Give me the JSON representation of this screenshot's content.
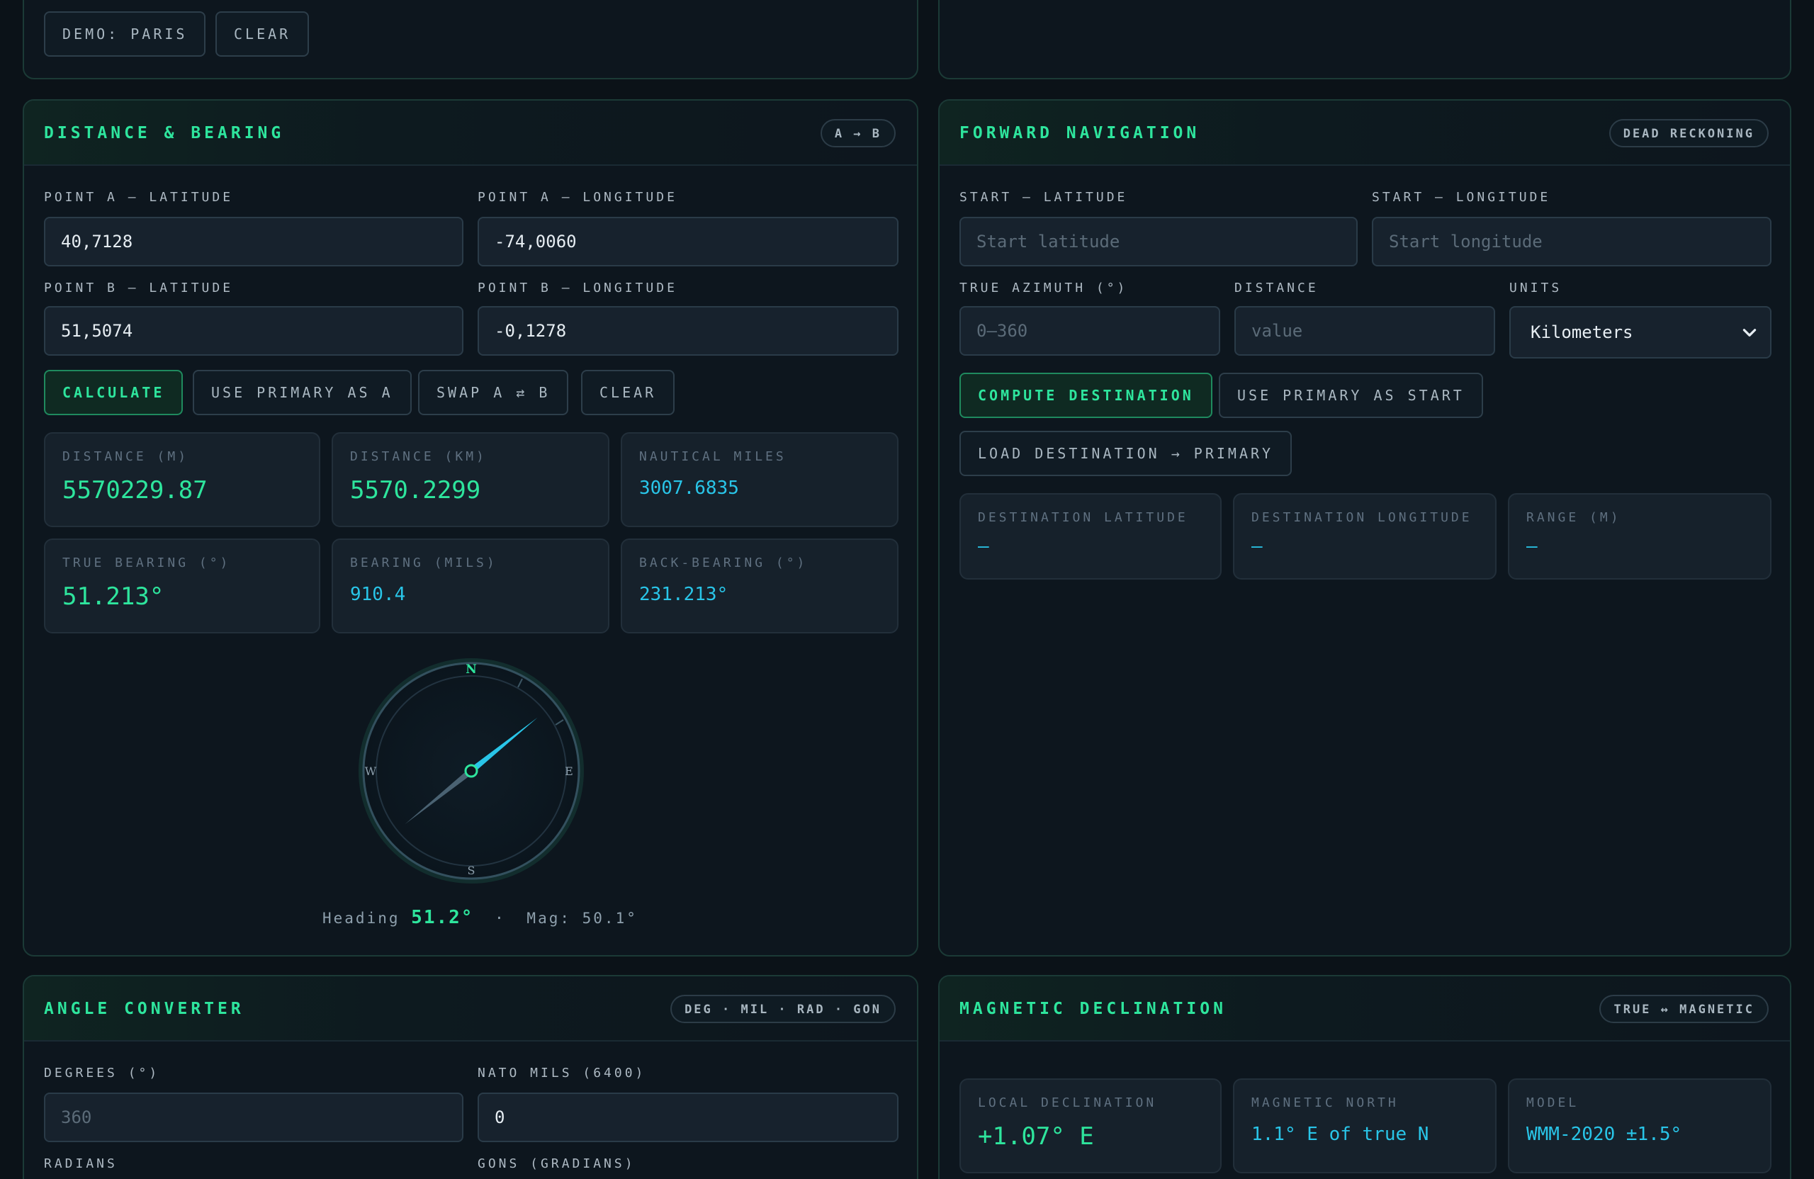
{
  "top_panel": {
    "demo_button": "DEMO: PARIS",
    "clear_button": "CLEAR"
  },
  "distance_bearing": {
    "title": "DISTANCE & BEARING",
    "badge": "A → B",
    "labels": {
      "a_lat": "POINT A — LATITUDE",
      "a_lon": "POINT A — LONGITUDE",
      "b_lat": "POINT B — LATITUDE",
      "b_lon": "POINT B — LONGITUDE"
    },
    "values": {
      "a_lat": "40,7128",
      "a_lon": "-74,0060",
      "b_lat": "51,5074",
      "b_lon": "-0,1278"
    },
    "buttons": {
      "calculate": "CALCULATE",
      "use_primary": "USE PRIMARY AS A",
      "swap": "SWAP A ⇄ B",
      "clear": "CLEAR"
    },
    "results": [
      {
        "label": "DISTANCE (M)",
        "value": "5570229.87"
      },
      {
        "label": "DISTANCE (KM)",
        "value": "5570.2299"
      },
      {
        "label": "NAUTICAL MILES",
        "value": "3007.6835"
      },
      {
        "label": "TRUE BEARING (°)",
        "value": "51.213°"
      },
      {
        "label": "BEARING (MILS)",
        "value": "910.4"
      },
      {
        "label": "BACK-BEARING (°)",
        "value": "231.213°"
      }
    ],
    "compass": {
      "n": "N",
      "e": "E",
      "s": "S",
      "w": "W",
      "bearing_deg": 51.2,
      "needle_color": "#29c5e8"
    },
    "heading": {
      "label": "Heading",
      "value": "51.2°",
      "separator": "·",
      "mag": "Mag: 50.1°"
    }
  },
  "forward_nav": {
    "title": "FORWARD NAVIGATION",
    "badge": "DEAD RECKONING",
    "labels": {
      "start_lat": "START — LATITUDE",
      "start_lon": "START — LONGITUDE",
      "azimuth": "TRUE AZIMUTH (°)",
      "distance": "DISTANCE",
      "units": "UNITS"
    },
    "placeholders": {
      "start_lat": "Start latitude",
      "start_lon": "Start longitude",
      "azimuth": "0–360",
      "distance": "value"
    },
    "units_value": "Kilometers",
    "buttons": {
      "compute": "COMPUTE DESTINATION",
      "use_primary": "USE PRIMARY AS START",
      "load": "LOAD DESTINATION → PRIMARY"
    },
    "results": [
      {
        "label": "DESTINATION LATITUDE",
        "value": "—"
      },
      {
        "label": "DESTINATION LONGITUDE",
        "value": "—"
      },
      {
        "label": "RANGE (M)",
        "value": "—"
      }
    ]
  },
  "angle_converter": {
    "title": "ANGLE CONVERTER",
    "badge": "DEG · MIL · RAD · GON",
    "labels": {
      "degrees": "DEGREES (°)",
      "mils": "NATO MILS (6400)",
      "radians": "RADIANS",
      "gons": "GONS (GRADIANS)"
    },
    "placeholders": {
      "degrees": "360"
    },
    "values": {
      "mils": "0"
    }
  },
  "magnetic": {
    "title": "MAGNETIC DECLINATION",
    "badge": "TRUE ↔ MAGNETIC",
    "results": [
      {
        "label": "LOCAL DECLINATION",
        "value": "+1.07° E"
      },
      {
        "label": "MAGNETIC NORTH",
        "value": "1.1° E of true N"
      },
      {
        "label": "MODEL",
        "value": "WMM-2020 ±1.5°"
      }
    ]
  },
  "colors": {
    "accent": "#2ee59d",
    "cyan": "#29c5e8",
    "background": "#0b1218"
  }
}
